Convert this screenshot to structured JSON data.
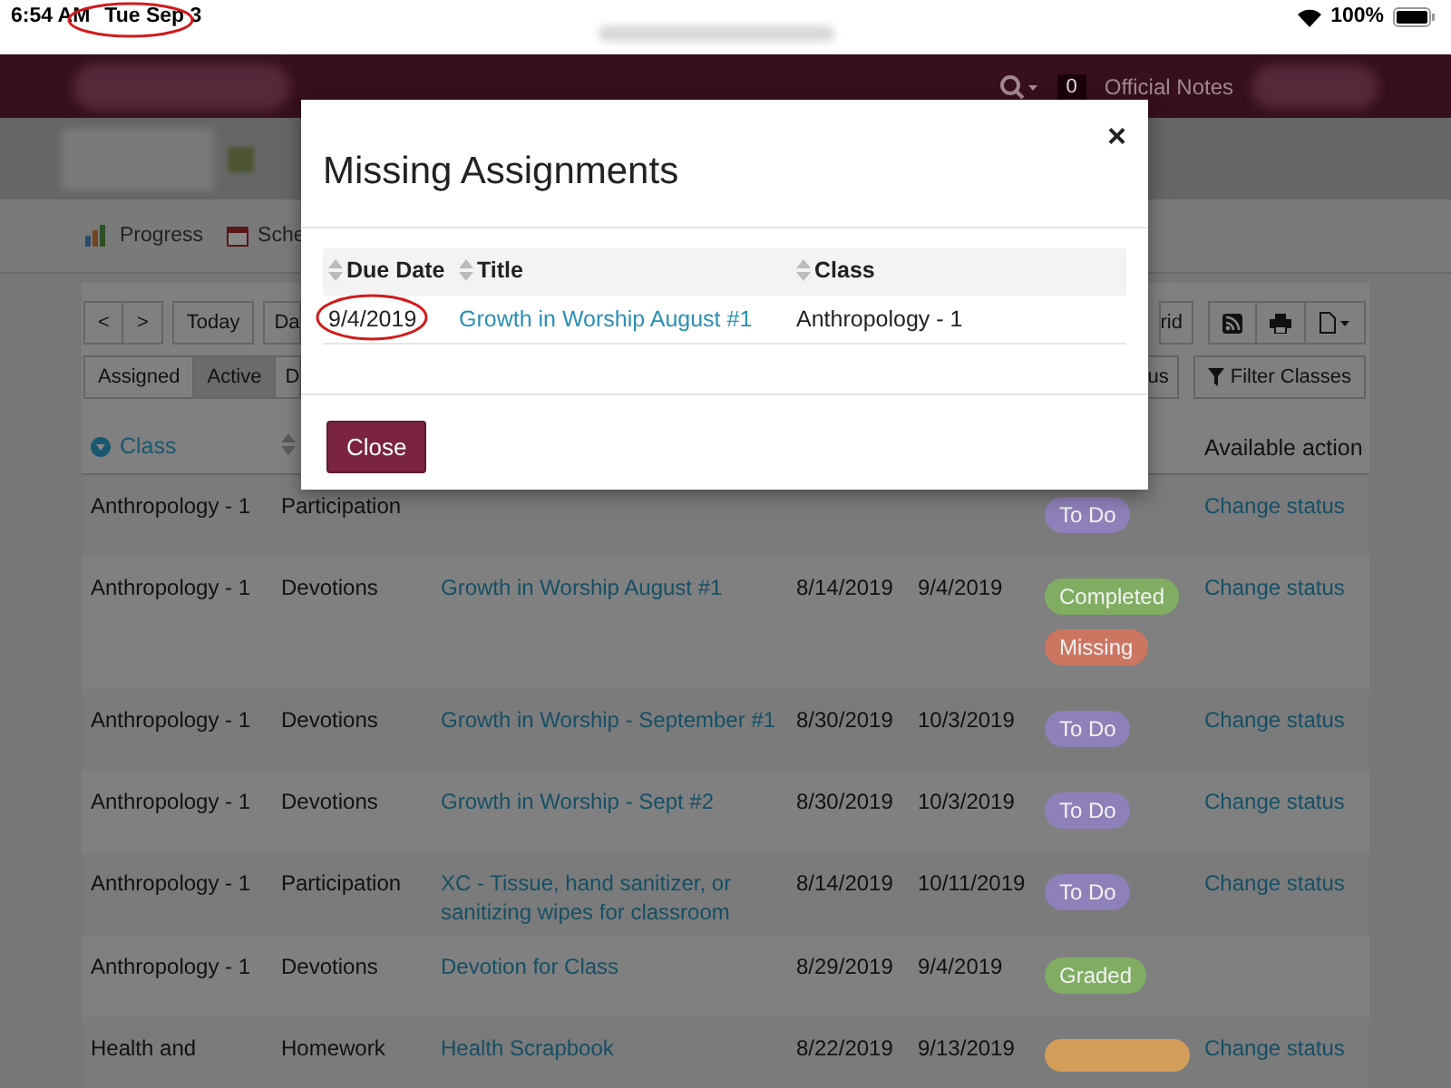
{
  "status_bar": {
    "time": "6:54 AM",
    "date": "Tue Sep 3",
    "battery": "100%"
  },
  "header": {
    "notes_count": "0",
    "notes_label": "Official Notes"
  },
  "nav": {
    "items": [
      {
        "label": "Progress"
      },
      {
        "label": "Sche"
      }
    ]
  },
  "toolbar": {
    "left": [
      "<",
      ">",
      "Today",
      "Da"
    ],
    "right_label": "rid"
  },
  "filters": {
    "items": [
      {
        "label": "Assigned",
        "selected": false
      },
      {
        "label": "Active",
        "selected": true
      },
      {
        "label": "D",
        "selected": false
      }
    ],
    "right_label": "us",
    "filter_button": "Filter Classes"
  },
  "table": {
    "columns": [
      {
        "label": "Class",
        "kind": "sorted"
      },
      {
        "kind": "sort"
      },
      {
        "label": "Available action",
        "kind": "plain"
      }
    ],
    "rows": [
      {
        "class": "Anthropology - 1",
        "type": "Participation",
        "statuses": [
          {
            "label": "To Do",
            "color": "#8e80b8"
          }
        ],
        "action": "Change status"
      },
      {
        "class": "Anthropology - 1",
        "type": "Devotions",
        "title": "Growth in Worship August #1",
        "assigned": "8/14/2019",
        "due": "9/4/2019",
        "statuses": [
          {
            "label": "Completed",
            "color": "#80ad62"
          },
          {
            "label": "Missing",
            "color": "#cc7662"
          }
        ],
        "action": "Change status"
      },
      {
        "class": "Anthropology - 1",
        "type": "Devotions",
        "title": "Growth in Worship - September #1",
        "assigned": "8/30/2019",
        "due": "10/3/2019",
        "statuses": [
          {
            "label": "To Do",
            "color": "#8e80b8"
          }
        ],
        "action": "Change status"
      },
      {
        "class": "Anthropology - 1",
        "type": "Devotions",
        "title": "Growth in Worship - Sept #2",
        "assigned": "8/30/2019",
        "due": "10/3/2019",
        "statuses": [
          {
            "label": "To Do",
            "color": "#8e80b8"
          }
        ],
        "action": "Change status"
      },
      {
        "class": "Anthropology - 1",
        "type": "Participation",
        "title": "XC - Tissue, hand sanitizer, or sanitizing wipes for classroom",
        "assigned": "8/14/2019",
        "due": "10/11/2019",
        "statuses": [
          {
            "label": "To Do",
            "color": "#8e80b8"
          }
        ],
        "action": "Change status"
      },
      {
        "class": "Anthropology - 1",
        "type": "Devotions",
        "title": "Devotion for Class",
        "assigned": "8/29/2019",
        "due": "9/4/2019",
        "statuses": [
          {
            "label": "Graded",
            "color": "#80ad62"
          }
        ]
      },
      {
        "class": "Health and",
        "type": "Homework",
        "title": "Health Scrapbook",
        "assigned": "8/22/2019",
        "due": "9/13/2019",
        "statuses": [
          {
            "color": "#d39e5a"
          }
        ],
        "action": "Change status"
      }
    ]
  },
  "modal": {
    "title": "Missing Assignments",
    "close_icon": "×",
    "columns": [
      "Due Date",
      "Title",
      "Class"
    ],
    "rows": [
      {
        "due": "9/4/2019",
        "title": "Growth in Worship August #1",
        "class": "Anthropology - 1"
      }
    ],
    "button": "Close"
  }
}
